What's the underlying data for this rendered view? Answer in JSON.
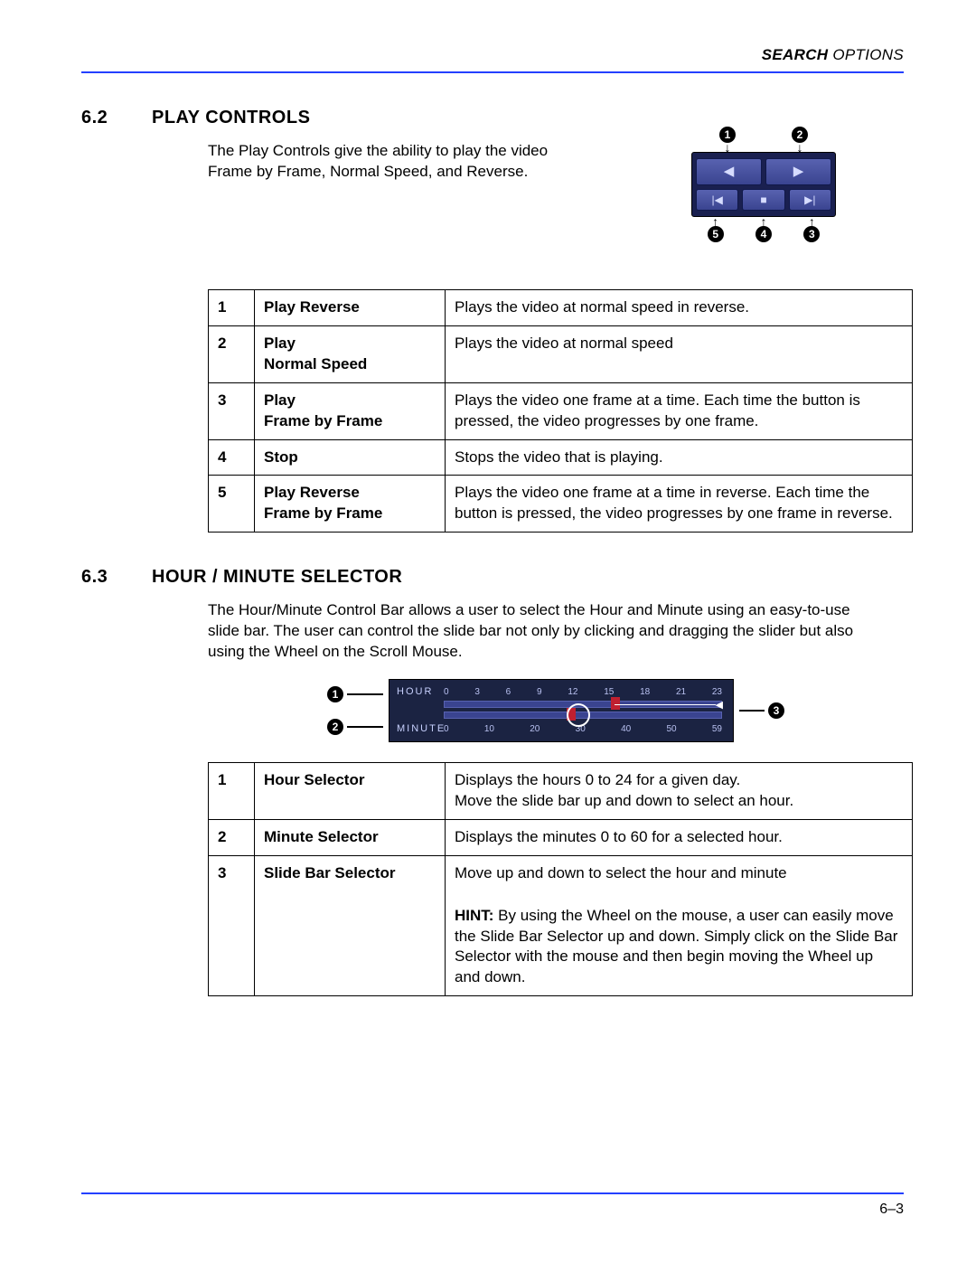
{
  "header": {
    "bold": "SEARCH",
    "rest": " OPTIONS"
  },
  "section1": {
    "num": "6.2",
    "title": "PLAY CONTROLS",
    "intro": "The Play Controls give the ability to play the video Frame by Frame, Normal Speed, and Reverse.",
    "callout_top": [
      "1",
      "2"
    ],
    "callout_bot": [
      "5",
      "4",
      "3"
    ],
    "rows": [
      {
        "n": "1",
        "name": "Play Reverse",
        "desc": "Plays the video at normal speed in reverse."
      },
      {
        "n": "2",
        "name": "Play\nNormal Speed",
        "desc": "Plays the video at normal speed"
      },
      {
        "n": "3",
        "name": "Play\nFrame by Frame",
        "desc": "Plays the video one frame at a time. Each time the button is pressed, the video progresses by one frame."
      },
      {
        "n": "4",
        "name": "Stop",
        "desc": "Stops the video that is playing."
      },
      {
        "n": "5",
        "name": "Play Reverse\nFrame by Frame",
        "desc": "Plays the video one frame at a time in reverse. Each time the button is pressed, the video progresses by one frame in reverse."
      }
    ]
  },
  "section2": {
    "num": "6.3",
    "title": "HOUR / MINUTE SELECTOR",
    "intro": "The Hour/Minute Control Bar allows a user to select the Hour and Minute using an easy-to-use slide bar. The user can control the slide bar not only by clicking and dragging the slider but also using the Wheel on the Scroll Mouse.",
    "hour_label": "HOUR",
    "hour_ticks": [
      "0",
      "3",
      "6",
      "9",
      "12",
      "15",
      "18",
      "21",
      "23"
    ],
    "minute_label": "MINUTE",
    "minute_ticks": [
      "0",
      "10",
      "20",
      "30",
      "40",
      "50",
      "59"
    ],
    "left_calls": [
      "1",
      "2"
    ],
    "right_call": "3",
    "rows": [
      {
        "n": "1",
        "name": "Hour Selector",
        "desc": "Displays the hours 0 to 24 for a given day.\nMove the slide bar up and down to select an hour."
      },
      {
        "n": "2",
        "name": "Minute Selector",
        "desc": "Displays the minutes 0 to 60 for a selected hour."
      },
      {
        "n": "3",
        "name": "Slide Bar Selector",
        "desc": "Move up and down to select the hour and minute",
        "hint_label": "HINT:",
        "hint": "  By using the Wheel on the mouse, a user can easily move the Slide Bar Selector up and down. Simply click on the Slide Bar Selector with the mouse and then begin moving the Wheel up and down."
      }
    ]
  },
  "page_number": "6–3"
}
